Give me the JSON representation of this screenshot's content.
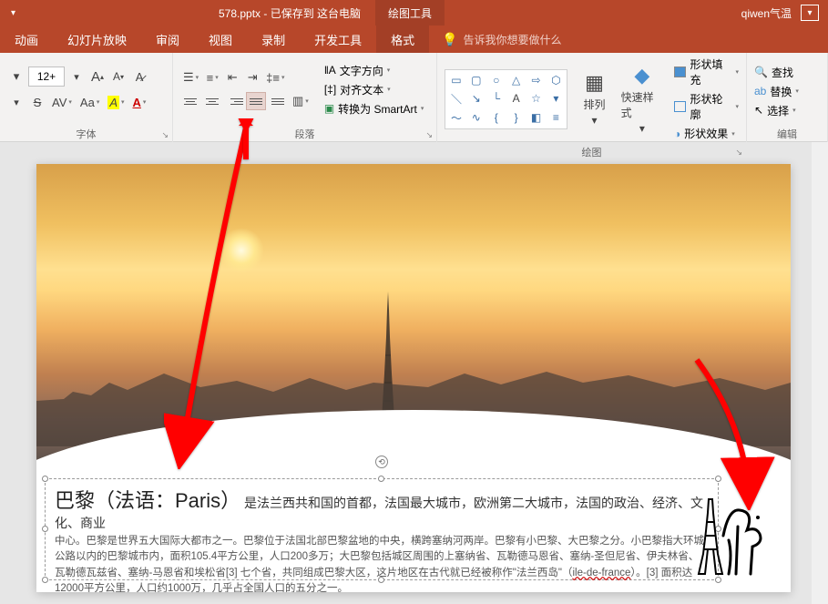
{
  "titlebar": {
    "filename": "578.pptx - 已保存到 这台电脑",
    "drawing_tools": "绘图工具",
    "user": "qiwen气温"
  },
  "tabs": {
    "items": [
      "动画",
      "幻灯片放映",
      "审阅",
      "视图",
      "录制",
      "开发工具",
      "格式"
    ],
    "active_index": 6,
    "tell_me": "告诉我你想要做什么"
  },
  "ribbon": {
    "font": {
      "label": "字体",
      "size_value": "12+",
      "inc_a": "A",
      "dec_a": "A",
      "clear": "Aφ",
      "strike": "S",
      "spacing": "AV",
      "case": "Aa"
    },
    "paragraph": {
      "label": "段落",
      "text_direction": "文字方向",
      "align_text": "对齐文本",
      "convert_smartart": "转换为 SmartArt"
    },
    "drawing": {
      "label": "绘图",
      "arrange": "排列",
      "quick_styles": "快速样式",
      "shape_fill": "形状填充",
      "shape_outline": "形状轮廓",
      "shape_effects": "形状效果"
    },
    "edit": {
      "label": "编辑",
      "find": "查找",
      "replace": "替换",
      "select": "选择"
    }
  },
  "slide": {
    "title_big": "巴黎（法语：Paris）",
    "title_rest": "是法兰西共和国的首都，法国最大城市，欧洲第二大城市，法国的政治、经济、文化、商业",
    "body": "中心。巴黎是世界五大国际大都市之一。巴黎位于法国北部巴黎盆地的中央，横跨塞纳河两岸。巴黎有小巴黎、大巴黎之分。小巴黎指大环城公路以内的巴黎城市内，面积105.4平方公里，人口200多万；大巴黎包括城区周围的上塞纳省、瓦勒德马恩省、塞纳-圣但尼省、伊夫林省、瓦勒德瓦兹省、塞纳-马恩省和埃松省[3]    七个省，共同组成巴黎大区，这片地区在古代就已经被称作\"法兰西岛\"（",
    "squiggle": "ile-de-france",
    "body_end": "）。[3]   面积达12000平方公里，人口约1000万，几乎占全国人口的五分之一。"
  }
}
